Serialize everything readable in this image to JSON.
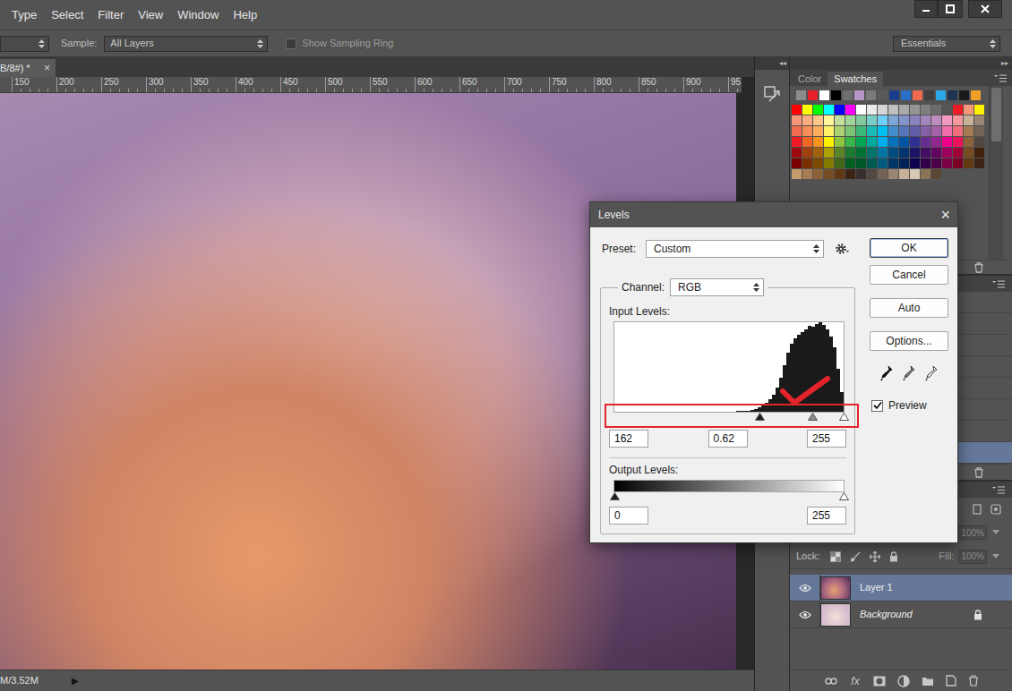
{
  "menu": [
    "Type",
    "Select",
    "Filter",
    "View",
    "Window",
    "Help"
  ],
  "options_bar": {
    "sample_label": "Sample:",
    "sample": "All Layers",
    "sampling_ring": {
      "label": "Show Sampling Ring",
      "checked": false
    },
    "workspace": "Essentials"
  },
  "document": {
    "tab": {
      "title": "B/8#) *",
      "close": "×"
    },
    "ruler": [
      "150",
      "200",
      "250",
      "300",
      "350",
      "400",
      "450",
      "500",
      "550",
      "600",
      "650",
      "700",
      "750",
      "800",
      "850",
      "900",
      "95"
    ],
    "status": "M/3.52M",
    "status_arrow": "▶"
  },
  "panel_dock": {
    "collapse": "◂◂",
    "expand": "▸▸"
  },
  "swatches_panel": {
    "tabs": [
      {
        "label": "Color",
        "selected": false
      },
      {
        "label": "Swatches",
        "selected": true
      }
    ],
    "recent": [
      {
        "color": "#8c8c8c"
      },
      {
        "color": "#e8202a"
      },
      {
        "color": "#ffffff"
      },
      {
        "color": "#000000"
      },
      {
        "color": "#6e6e6e"
      },
      {
        "color": "#b896c8"
      },
      {
        "color": "#7a7a7a"
      },
      {
        "color": "#5a5a5a"
      },
      {
        "color": "#1c3c8c"
      },
      {
        "color": "#2a6ec8"
      },
      {
        "color": "#f06a50"
      },
      {
        "color": "#404040"
      },
      {
        "color": "#2aa8e8"
      },
      {
        "color": "#1e3450"
      },
      {
        "color": "#1a1a1a"
      },
      {
        "color": "#f0a028"
      }
    ],
    "grid": [
      [
        {
          "color": "#ff0000"
        },
        {
          "color": "#ffff00"
        },
        {
          "color": "#00ff00"
        },
        {
          "color": "#00ffff"
        },
        {
          "color": "#0000ff"
        },
        {
          "color": "#ff00ff"
        },
        {
          "color": "#ffffff"
        },
        {
          "color": "#ebebeb"
        },
        {
          "color": "#d6d6d6"
        },
        {
          "color": "#c0c0c0"
        },
        {
          "color": "#aaaaaa"
        },
        {
          "color": "#959595"
        },
        {
          "color": "#808080"
        },
        {
          "color": "#6b6b6b"
        },
        {
          "color": "#555555"
        },
        {
          "color": "#ee1d24"
        },
        {
          "color": "#f7977a"
        },
        {
          "color": "#fff200"
        }
      ],
      [
        {
          "color": "#f7977a"
        },
        {
          "color": "#f9ad81"
        },
        {
          "color": "#fdc68a"
        },
        {
          "color": "#fff79a"
        },
        {
          "color": "#c4df9b"
        },
        {
          "color": "#a3d39c"
        },
        {
          "color": "#82ca9d"
        },
        {
          "color": "#7bcdc8"
        },
        {
          "color": "#6ecff6"
        },
        {
          "color": "#7ea7d8"
        },
        {
          "color": "#8493ca"
        },
        {
          "color": "#8882be"
        },
        {
          "color": "#a187be"
        },
        {
          "color": "#bc8dbf"
        },
        {
          "color": "#f49ac2"
        },
        {
          "color": "#f6989d"
        },
        {
          "color": "#c7b299"
        },
        {
          "color": "#998675"
        }
      ],
      [
        {
          "color": "#f26c4f"
        },
        {
          "color": "#f68e55"
        },
        {
          "color": "#fbaf5c"
        },
        {
          "color": "#fff467"
        },
        {
          "color": "#acd372"
        },
        {
          "color": "#7cc576"
        },
        {
          "color": "#3bb878"
        },
        {
          "color": "#1abbb4"
        },
        {
          "color": "#00bff3"
        },
        {
          "color": "#438ccb"
        },
        {
          "color": "#5574b9"
        },
        {
          "color": "#605ca8"
        },
        {
          "color": "#855fa8"
        },
        {
          "color": "#a763a8"
        },
        {
          "color": "#f06ea9"
        },
        {
          "color": "#f26d7d"
        },
        {
          "color": "#a67c52"
        },
        {
          "color": "#736357"
        }
      ],
      [
        {
          "color": "#ed1c24"
        },
        {
          "color": "#f26522"
        },
        {
          "color": "#f7941d"
        },
        {
          "color": "#fff200"
        },
        {
          "color": "#8dc63f"
        },
        {
          "color": "#39b54a"
        },
        {
          "color": "#00a651"
        },
        {
          "color": "#00a99d"
        },
        {
          "color": "#00aeef"
        },
        {
          "color": "#0072bc"
        },
        {
          "color": "#0054a6"
        },
        {
          "color": "#2e3192"
        },
        {
          "color": "#662d91"
        },
        {
          "color": "#92278f"
        },
        {
          "color": "#ec008c"
        },
        {
          "color": "#ed145b"
        },
        {
          "color": "#8c6239"
        },
        {
          "color": "#534741"
        }
      ],
      [
        {
          "color": "#9e0b0f"
        },
        {
          "color": "#a0410d"
        },
        {
          "color": "#a36209"
        },
        {
          "color": "#aba000"
        },
        {
          "color": "#598527"
        },
        {
          "color": "#1a7b30"
        },
        {
          "color": "#007236"
        },
        {
          "color": "#00746b"
        },
        {
          "color": "#0076a3"
        },
        {
          "color": "#004b80"
        },
        {
          "color": "#003471"
        },
        {
          "color": "#1b1464"
        },
        {
          "color": "#440e62"
        },
        {
          "color": "#630460"
        },
        {
          "color": "#9e005d"
        },
        {
          "color": "#9e0039"
        },
        {
          "color": "#754c24"
        },
        {
          "color": "#42210b"
        }
      ],
      [
        {
          "color": "#790000"
        },
        {
          "color": "#7b2e00"
        },
        {
          "color": "#7d4900"
        },
        {
          "color": "#827b00"
        },
        {
          "color": "#406618"
        },
        {
          "color": "#005e20"
        },
        {
          "color": "#005826"
        },
        {
          "color": "#005952"
        },
        {
          "color": "#005b7f"
        },
        {
          "color": "#003663"
        },
        {
          "color": "#002157"
        },
        {
          "color": "#0d004c"
        },
        {
          "color": "#32004b"
        },
        {
          "color": "#4b0049"
        },
        {
          "color": "#7b0046"
        },
        {
          "color": "#7a0026"
        },
        {
          "color": "#603913"
        },
        {
          "color": "#3c2415"
        }
      ],
      [
        {
          "color": "#c69c6d"
        },
        {
          "color": "#a67c52"
        },
        {
          "color": "#8c6239"
        },
        {
          "color": "#754c24"
        },
        {
          "color": "#603913"
        },
        {
          "color": "#3c2415"
        },
        {
          "color": "#362f2d"
        },
        {
          "color": "#534741"
        },
        {
          "color": "#736357"
        },
        {
          "color": "#998675"
        },
        {
          "color": "#c7b299"
        },
        {
          "color": "#d7c9b5"
        },
        {
          "color": "#8b7355"
        },
        {
          "color": "#5a4632"
        }
      ]
    ]
  },
  "history_panel": {
    "rows": [
      {
        "selected": false
      },
      {
        "selected": false
      },
      {
        "selected": false
      },
      {
        "selected": false
      },
      {
        "selected": false
      },
      {
        "selected": false
      },
      {
        "selected": false
      },
      {
        "selected": true
      }
    ]
  },
  "layers_panel": {
    "opacity": {
      "value": "100%",
      "disabled": true
    },
    "lock_label": "Lock:",
    "fill_label": "Fill:",
    "fill": {
      "value": "100%",
      "disabled": true
    },
    "layers": [
      {
        "name": "Layer 1",
        "kind": "layer",
        "visible": true,
        "selected": true,
        "locked": false
      },
      {
        "name": "Background",
        "kind": "background",
        "visible": true,
        "selected": false,
        "locked": true
      }
    ],
    "footer_fx": "fx"
  },
  "levels_dialog": {
    "title": "Levels",
    "close": "×",
    "preset_label": "Preset:",
    "preset": "Custom",
    "channel_label": "Channel:",
    "channel": "RGB",
    "input_label": "Input Levels:",
    "histogram": [
      0,
      0,
      0,
      0,
      0,
      0,
      0,
      0,
      0,
      0,
      0,
      0,
      0,
      0,
      0,
      0,
      0,
      0,
      0,
      0,
      0,
      0,
      0,
      0,
      0,
      0,
      0,
      0,
      0,
      0,
      0,
      0,
      0,
      0,
      1,
      1,
      1,
      1,
      2,
      3,
      5,
      7,
      10,
      14,
      19,
      27,
      38,
      52,
      66,
      76,
      82,
      86,
      89,
      92,
      96,
      95,
      98,
      100,
      97,
      92,
      84,
      72,
      48,
      22
    ],
    "input_sliders": [
      {
        "value": "162",
        "level": 0.635,
        "kind": "black"
      },
      {
        "value": "0.62",
        "level": 0.867,
        "kind": "gray"
      },
      {
        "value": "255",
        "level": 1,
        "kind": "white"
      }
    ],
    "output_label": "Output Levels:",
    "output_sliders": [
      {
        "value": "0",
        "level": 0,
        "kind": "black"
      },
      {
        "value": "255",
        "level": 1,
        "kind": "white"
      }
    ],
    "buttons": [
      {
        "label": "OK",
        "default": true
      },
      {
        "label": "Cancel",
        "default": false
      },
      {
        "label": "Auto",
        "default": false
      },
      {
        "label": "Options...",
        "default": false
      }
    ],
    "preview": {
      "label": "Preview",
      "checked": true
    }
  }
}
